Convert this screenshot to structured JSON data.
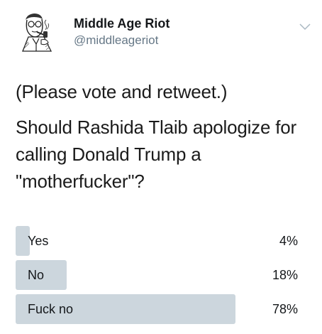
{
  "author": {
    "display_name": "Middle Age Riot",
    "handle": "@middleageriot",
    "avatar_icon": "pipe-smoking-man-avatar-icon"
  },
  "menu_icon": "chevron-down-icon",
  "tweet": {
    "line1": "(Please vote and retweet.)",
    "line2": "Should Rashida Tlaib apologize for calling Donald Trump a \"motherfucker\"?"
  },
  "poll": {
    "options": [
      {
        "label": "Yes",
        "percent_text": "4%",
        "percent": 4
      },
      {
        "label": "No",
        "percent_text": "18%",
        "percent": 18
      },
      {
        "label": "Fuck no",
        "percent_text": "78%",
        "percent": 78
      }
    ]
  },
  "colors": {
    "bar": "#ccd6dd",
    "handle": "#657786",
    "text": "#1b1b1b"
  }
}
